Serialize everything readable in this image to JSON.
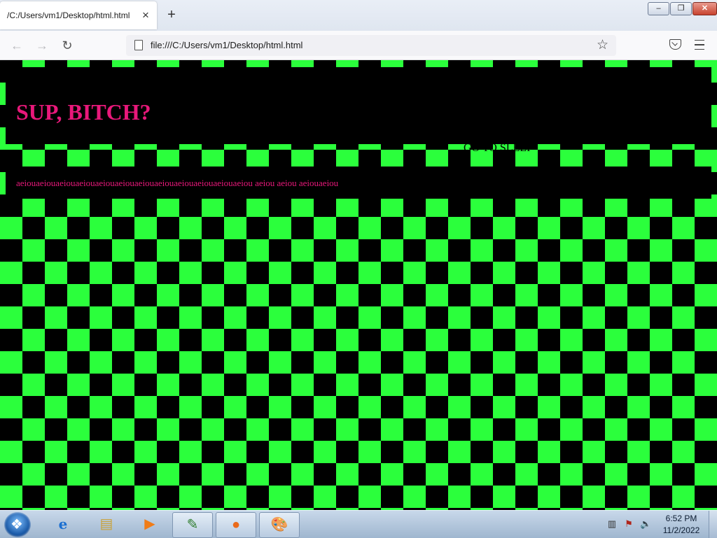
{
  "browser": {
    "tab_title": "/C:/Users/vm1/Desktop/html.html",
    "tab_close": "×",
    "new_tab": "+",
    "url": "file:///C:/Users/vm1/Desktop/html.html",
    "window_buttons": {
      "minimize": "–",
      "maximize": "❐",
      "close": "✕"
    },
    "nav": {
      "back": "←",
      "forward": "→",
      "reload": "↻",
      "bookmark": "☆"
    }
  },
  "page": {
    "heading": "SUP, BITCH?",
    "sleep_text": "GO TO SLEEP",
    "vowel_text": "aeiouaeiouaeiouaeiouaeiouaeiouaeiouaeiouaeiouaeiouaeiouaeiou aeiou aeiou aeiouaeiou",
    "colors": {
      "accent": "#e8187a",
      "checker": "#2bff3c",
      "background": "#000000"
    }
  },
  "taskbar": {
    "items": [
      "internet-explorer",
      "windows-explorer",
      "media-player",
      "notepad",
      "firefox",
      "paint"
    ],
    "clock_time": "6:52 PM",
    "clock_date": "11/2/2022"
  }
}
